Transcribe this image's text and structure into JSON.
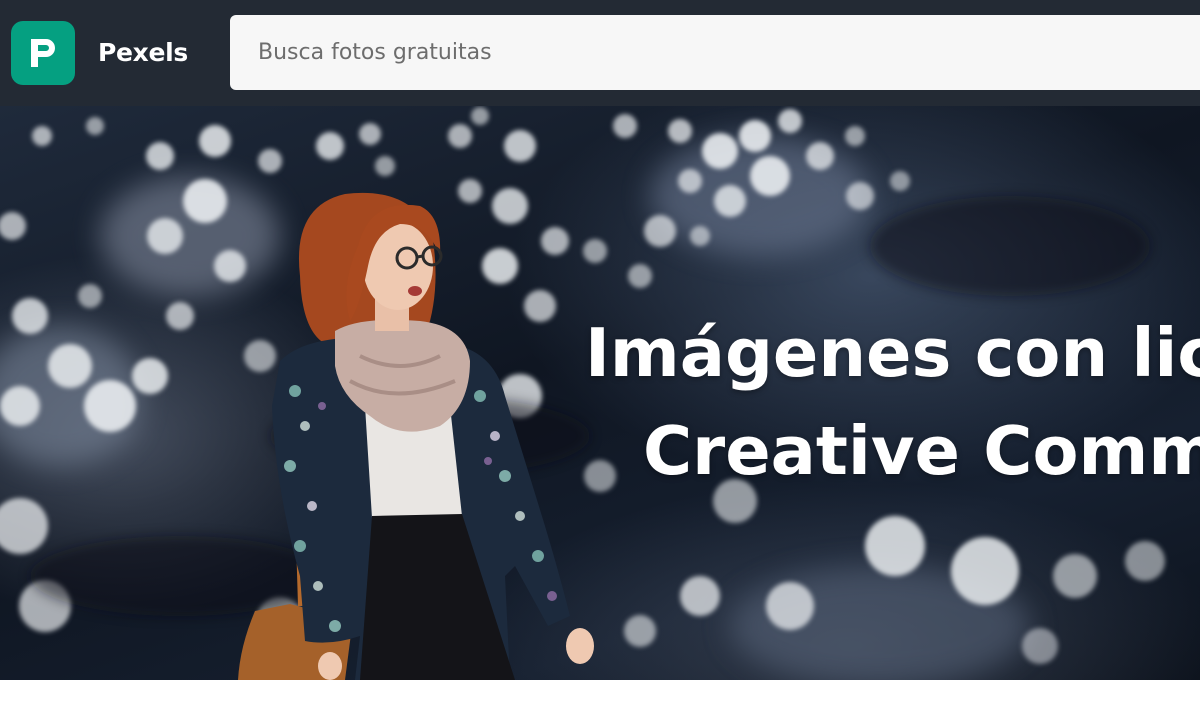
{
  "header": {
    "brand_name": "Pexels",
    "logo_icon": "pexels-p-logo-icon",
    "search": {
      "placeholder": "Busca fotos gratuitas",
      "value": ""
    }
  },
  "hero": {
    "headline_line1": "Imágenes con lic",
    "headline_line2": "Creative Comm",
    "photo_subject": "woman-with-scarf-photo"
  },
  "colors": {
    "topbar": "#232a34",
    "logo_bg": "#05a081",
    "search_bg": "#f7f7f7",
    "headline": "#ffffff"
  }
}
